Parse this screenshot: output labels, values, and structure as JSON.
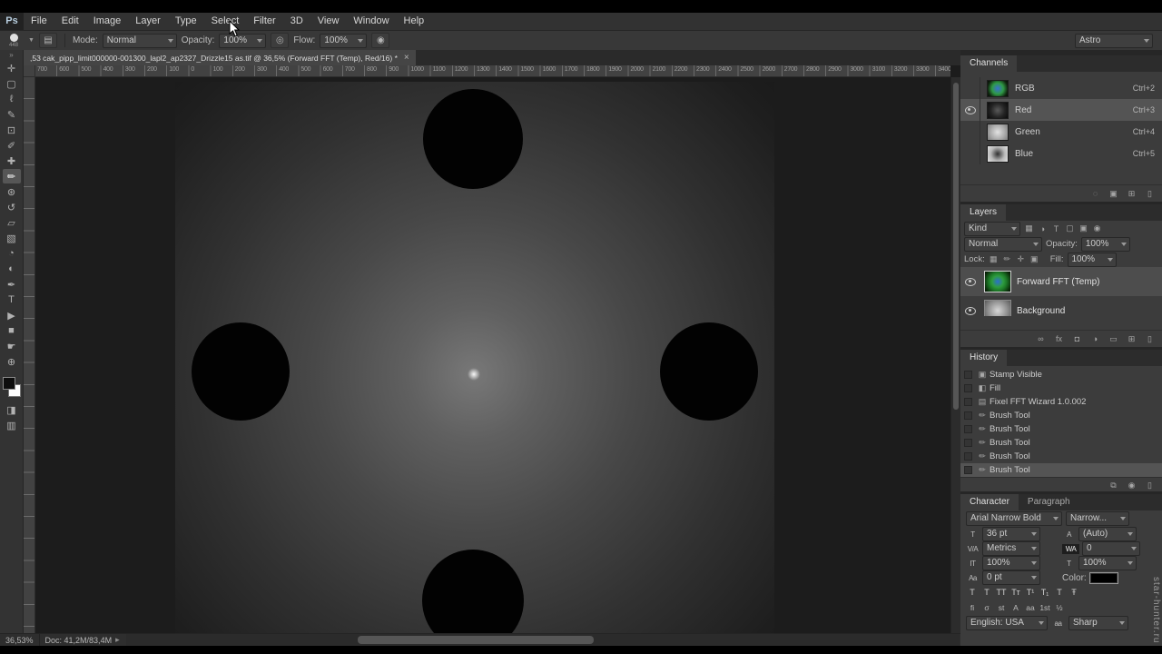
{
  "chrome": {
    "logo": "Ps",
    "menus": [
      "File",
      "Edit",
      "Image",
      "Layer",
      "Type",
      "Select",
      "Filter",
      "3D",
      "View",
      "Window",
      "Help"
    ],
    "workspace": "Astro"
  },
  "options": {
    "brush_size": "448",
    "toggle_panel_glyph": "▤",
    "mode_label": "Mode:",
    "mode_value": "Normal",
    "opacity_label": "Opacity:",
    "opacity_value": "100%",
    "pressure_glyph": "◎",
    "flow_label": "Flow:",
    "flow_value": "100%",
    "airbrush_glyph": "◉"
  },
  "tabbar": {
    "title": ",53 cak_pipp_limit000000-001300_lapl2_ap2327_Drizzle15 as.tif @ 36,5% (Forward FFT (Temp), Red/16) *",
    "close": "×"
  },
  "ruler": {
    "ticks": [
      "700",
      "600",
      "500",
      "400",
      "300",
      "200",
      "100",
      "0",
      "100",
      "200",
      "300",
      "400",
      "500",
      "600",
      "700",
      "800",
      "900",
      "1000",
      "1100",
      "1200",
      "1300",
      "1400",
      "1500",
      "1600",
      "1700",
      "1800",
      "1900",
      "2000",
      "2100",
      "2200",
      "2300",
      "2400",
      "2500",
      "2600",
      "2700",
      "2800",
      "2900",
      "3000",
      "3100",
      "3200",
      "3300",
      "3400"
    ]
  },
  "toolbar": {
    "collapse": "»",
    "quick_mask_glyph": "◨",
    "screen_mode_glyph": "▥",
    "tools": [
      {
        "name": "move-tool",
        "glyph": "✛"
      },
      {
        "name": "marquee-tool",
        "glyph": "▢"
      },
      {
        "name": "lasso-tool",
        "glyph": "ℓ"
      },
      {
        "name": "quick-selection-tool",
        "glyph": "✎"
      },
      {
        "name": "crop-tool",
        "glyph": "⊡"
      },
      {
        "name": "eyedropper-tool",
        "glyph": "✐"
      },
      {
        "name": "healing-brush-tool",
        "glyph": "✚"
      },
      {
        "name": "brush-tool",
        "glyph": "✏",
        "selected": true
      },
      {
        "name": "clone-stamp-tool",
        "glyph": "⊛"
      },
      {
        "name": "history-brush-tool",
        "glyph": "↺"
      },
      {
        "name": "eraser-tool",
        "glyph": "▱"
      },
      {
        "name": "gradient-tool",
        "glyph": "▧"
      },
      {
        "name": "blur-tool",
        "glyph": "◔"
      },
      {
        "name": "dodge-tool",
        "glyph": "◐"
      },
      {
        "name": "pen-tool",
        "glyph": "✒"
      },
      {
        "name": "type-tool",
        "glyph": "T"
      },
      {
        "name": "path-selection-tool",
        "glyph": "▶"
      },
      {
        "name": "shape-tool",
        "glyph": "■"
      },
      {
        "name": "hand-tool",
        "glyph": "☛"
      },
      {
        "name": "zoom-tool",
        "glyph": "⊕"
      }
    ]
  },
  "channels": {
    "title": "Channels",
    "items": [
      {
        "name": "RGB",
        "shortcut": "Ctrl+2",
        "thumb": "rgb",
        "eye": false,
        "selected": false
      },
      {
        "name": "Red",
        "shortcut": "Ctrl+3",
        "thumb": "red",
        "eye": true,
        "selected": true
      },
      {
        "name": "Green",
        "shortcut": "Ctrl+4",
        "thumb": "green",
        "eye": false,
        "selected": false
      },
      {
        "name": "Blue",
        "shortcut": "Ctrl+5",
        "thumb": "blue",
        "eye": false,
        "selected": false
      }
    ],
    "actions": [
      {
        "name": "load-selection-icon",
        "glyph": "◌"
      },
      {
        "name": "save-selection-icon",
        "glyph": "▣"
      },
      {
        "name": "new-channel-icon",
        "glyph": "⊞"
      },
      {
        "name": "delete-channel-icon",
        "glyph": "▯"
      }
    ]
  },
  "layers": {
    "title": "Layers",
    "filter_label": "Kind",
    "filter_icons": [
      {
        "name": "filter-pixel-icon",
        "glyph": "▦"
      },
      {
        "name": "filter-adjustment-icon",
        "glyph": "◑"
      },
      {
        "name": "filter-type-icon",
        "glyph": "T"
      },
      {
        "name": "filter-shape-icon",
        "glyph": "▢"
      },
      {
        "name": "filter-smart-object-icon",
        "glyph": "▣"
      },
      {
        "name": "filter-toggle-icon",
        "glyph": "◉"
      }
    ],
    "blend_mode": "Normal",
    "opacity_label": "Opacity:",
    "opacity_value": "100%",
    "lock_label": "Lock:",
    "lock_icons": [
      {
        "name": "lock-transparency-icon",
        "glyph": "▦"
      },
      {
        "name": "lock-pixels-icon",
        "glyph": "✏"
      },
      {
        "name": "lock-position-icon",
        "glyph": "✛"
      },
      {
        "name": "lock-all-icon",
        "glyph": "▣"
      }
    ],
    "fill_label": "Fill:",
    "fill_value": "100%",
    "items": [
      {
        "name": "Forward FFT (Temp)",
        "thumb": "fft",
        "eye": true,
        "selected": true
      },
      {
        "name": "Background",
        "thumb": "bg",
        "eye": true,
        "selected": false
      }
    ],
    "actions": [
      {
        "name": "link-layers-icon",
        "glyph": "∞"
      },
      {
        "name": "layer-style-icon",
        "glyph": "fx"
      },
      {
        "name": "layer-mask-icon",
        "glyph": "◘"
      },
      {
        "name": "adjustment-layer-icon",
        "glyph": "◑"
      },
      {
        "name": "new-group-icon",
        "glyph": "▭"
      },
      {
        "name": "new-layer-icon",
        "glyph": "⊞"
      },
      {
        "name": "delete-layer-icon",
        "glyph": "▯"
      }
    ]
  },
  "history": {
    "title": "History",
    "items": [
      {
        "label": "Stamp Visible",
        "icon": "stamp-visible",
        "glyph": "▣",
        "selected": false
      },
      {
        "label": "Fill",
        "icon": "fill",
        "glyph": "◧",
        "selected": false
      },
      {
        "label": "Fixel FFT Wizard 1.0.002",
        "icon": "plugin",
        "glyph": "▤",
        "selected": false
      },
      {
        "label": "Brush Tool",
        "icon": "brush-tool",
        "glyph": "✏",
        "selected": false
      },
      {
        "label": "Brush Tool",
        "icon": "brush-tool",
        "glyph": "✏",
        "selected": false
      },
      {
        "label": "Brush Tool",
        "icon": "brush-tool",
        "glyph": "✏",
        "selected": false
      },
      {
        "label": "Brush Tool",
        "icon": "brush-tool",
        "glyph": "✏",
        "selected": false
      },
      {
        "label": "Brush Tool",
        "icon": "brush-tool",
        "glyph": "✏",
        "selected": true
      }
    ],
    "actions": [
      {
        "name": "new-document-from-state-icon",
        "glyph": "⧉"
      },
      {
        "name": "new-snapshot-icon",
        "glyph": "◉"
      },
      {
        "name": "delete-state-icon",
        "glyph": "▯"
      }
    ]
  },
  "character": {
    "tabs": [
      "Character",
      "Paragraph"
    ],
    "font_family": "Arial Narrow Bold",
    "font_style": "Narrow...",
    "size_icon": "T",
    "size_value": "36 pt",
    "leading_icon": "A",
    "leading_value": "(Auto)",
    "kerning_icon": "V/A",
    "kerning_value": "Metrics",
    "tracking_icon": "WA",
    "tracking_value": "0",
    "vscale_icon": "IT",
    "vscale_value": "100%",
    "hscale_icon": "T",
    "hscale_value": "100%",
    "baseline_icon": "Aa",
    "baseline_value": "0 pt",
    "color_label": "Color:",
    "style_buttons": [
      {
        "name": "faux-bold-button",
        "glyph": "T"
      },
      {
        "name": "faux-italic-button",
        "glyph": "T"
      },
      {
        "name": "all-caps-button",
        "glyph": "TT"
      },
      {
        "name": "small-caps-button",
        "glyph": "Tᴛ"
      },
      {
        "name": "superscript-button",
        "glyph": "T¹"
      },
      {
        "name": "subscript-button",
        "glyph": "T₁"
      },
      {
        "name": "underline-button",
        "glyph": "T"
      },
      {
        "name": "strikethrough-button",
        "glyph": "Ŧ"
      }
    ],
    "ligature_buttons": [
      {
        "name": "standard-ligatures-button",
        "glyph": "fi"
      },
      {
        "name": "contextual-alternates-button",
        "glyph": "σ"
      },
      {
        "name": "discretionary-ligatures-button",
        "glyph": "st"
      },
      {
        "name": "swash-button",
        "glyph": "A"
      },
      {
        "name": "stylistic-alternates-button",
        "glyph": "aa"
      },
      {
        "name": "titling-alternates-button",
        "glyph": "1st"
      },
      {
        "name": "fractions-button",
        "glyph": "½"
      }
    ],
    "language_value": "English: USA",
    "aa_label": "aa",
    "aa_value": "Sharp"
  },
  "status": {
    "zoom": "36,53%",
    "doc": "Doc: 41,2M/83,4M",
    "caret": "▸"
  },
  "watermark": {
    "text": "star-hunter.ru"
  }
}
